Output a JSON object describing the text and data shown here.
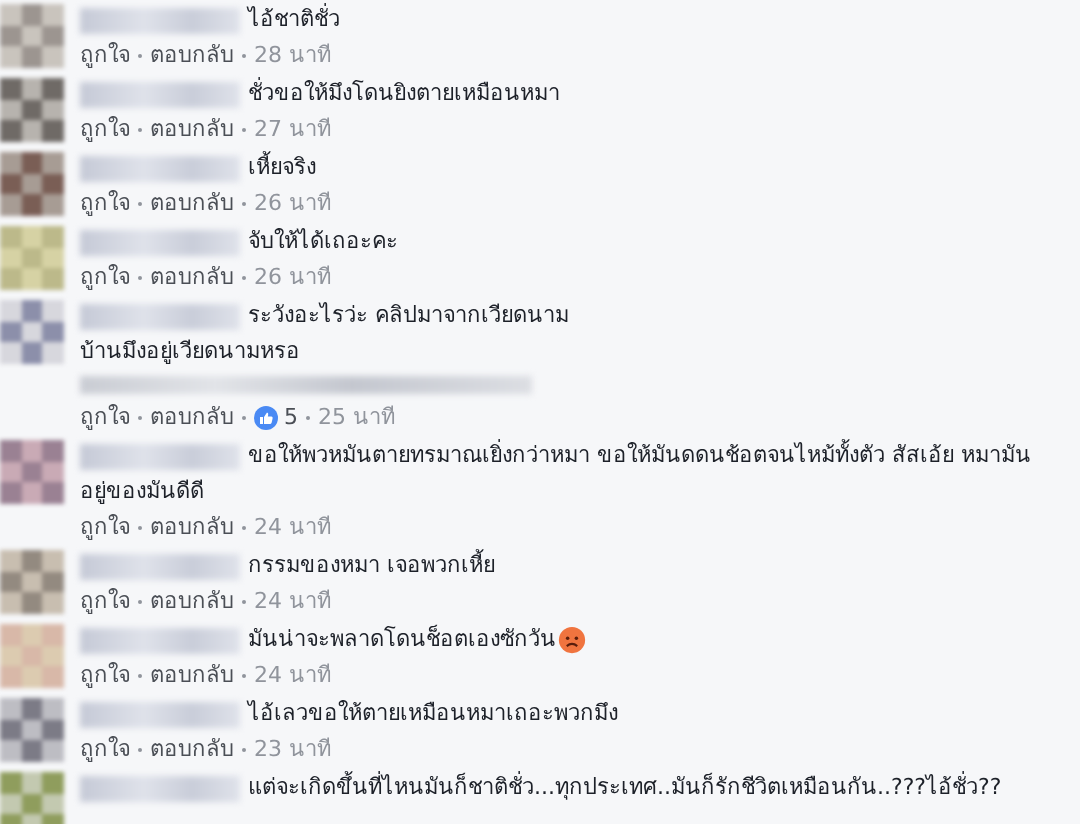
{
  "comments": [
    {
      "lines": [
        "ไอ้ชาติชั่ว"
      ],
      "like": "ถูกใจ",
      "reply": "ตอบกลับ",
      "time": "28 นาที"
    },
    {
      "lines": [
        "ชั่วขอให้มึงโดนยิงตายเหมือนหมา"
      ],
      "like": "ถูกใจ",
      "reply": "ตอบกลับ",
      "time": "27 นาที"
    },
    {
      "lines": [
        "เหี้ยจริง"
      ],
      "like": "ถูกใจ",
      "reply": "ตอบกลับ",
      "time": "26 นาที"
    },
    {
      "lines": [
        "จับให้ได้เถอะคะ"
      ],
      "like": "ถูกใจ",
      "reply": "ตอบกลับ",
      "time": "26 นาที"
    },
    {
      "lines": [
        "ระวังอะไรว่ะ คลิปมาจากเวียดนาม",
        "บ้านมึงอยู่เวียดนามหรอ"
      ],
      "has_attachment": true,
      "like": "ถูกใจ",
      "reply": "ตอบกลับ",
      "reactions": "5",
      "time": "25 นาที"
    },
    {
      "lines": [
        "ขอให้พวหมันตายทรมาณเยิ่งกว่าหมา ขอให้มันดดนช้อตจนไหม้ทั้งตัว สัสเอ้ย หมามัน",
        "อยู่ของมันดีดี"
      ],
      "like": "ถูกใจ",
      "reply": "ตอบกลับ",
      "time": "24 นาที"
    },
    {
      "lines": [
        "กรรมของหมา เจอพวกเหี้ย"
      ],
      "like": "ถูกใจ",
      "reply": "ตอบกลับ",
      "time": "24 นาที"
    },
    {
      "lines": [
        "มันน่าจะพลาดโดนช็อตเองซักวัน"
      ],
      "has_emoji": true,
      "like": "ถูกใจ",
      "reply": "ตอบกลับ",
      "time": "24 นาที"
    },
    {
      "lines": [
        "ไอ้เลวขอให้ตายเหมือนหมาเถอะพวกมึง"
      ],
      "like": "ถูกใจ",
      "reply": "ตอบกลับ",
      "time": "23 นาที"
    },
    {
      "lines": [
        "แต่จะเกิดขึ้นที่ไหนมันก็ชาติชั่ว...ทุกประเทศ..มันก็รักชีวิตเหมือนกัน..???ไอ้ชั่ว??"
      ]
    }
  ]
}
